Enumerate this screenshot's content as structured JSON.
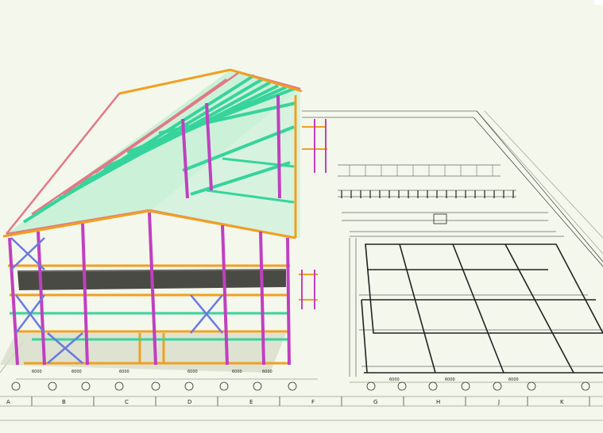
{
  "colors": {
    "background": "#f4f7ec",
    "roof_purlin": "#3fe0a8",
    "rafter": "#e07a86",
    "column": "#c040c0",
    "beam_orange": "#f0a020",
    "brace_blue": "#6a7ae0",
    "floor_slab": "#4a4a44",
    "drawing_line": "#222222"
  },
  "grid_axis_letters": [
    "A",
    "B",
    "C",
    "D",
    "E",
    "F",
    "G",
    "H",
    "J",
    "K"
  ],
  "dimension_labels": [
    "6000",
    "6000",
    "6000",
    "6000",
    "6000",
    "6000",
    "6000",
    "6000",
    "6000"
  ],
  "icons": [
    "structural-model-3d",
    "floor-plan-drawing"
  ]
}
